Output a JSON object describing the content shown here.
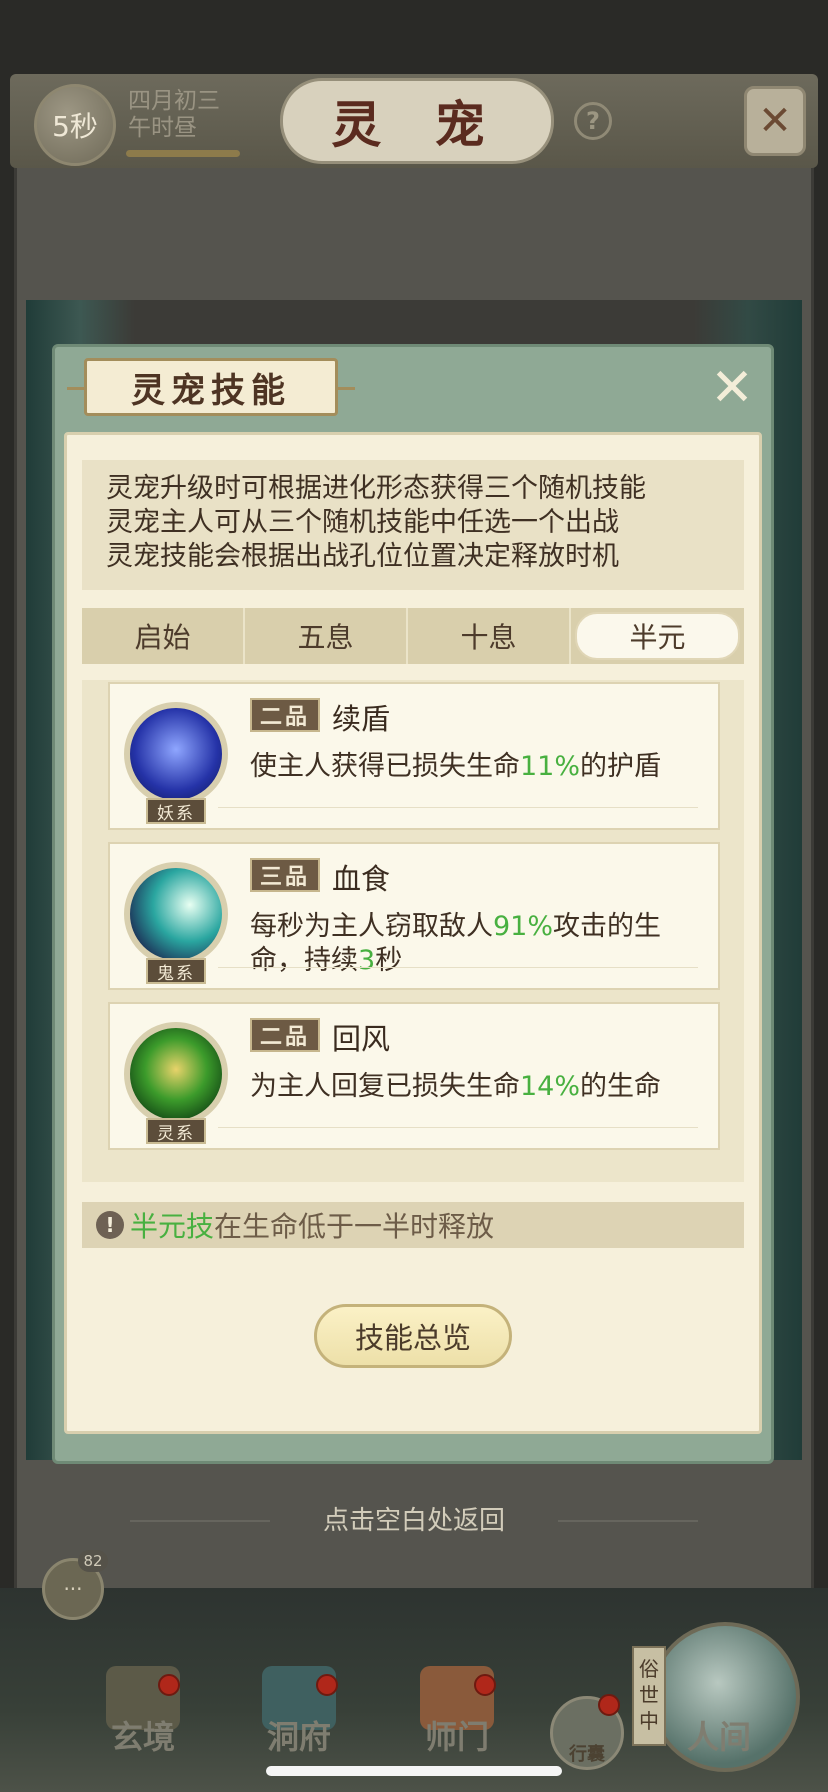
{
  "header": {
    "timer": "5秒",
    "date_line1": "四月初三",
    "date_line2": "午时昼",
    "title": "灵 宠",
    "help": "?"
  },
  "modal": {
    "title": "灵宠技能",
    "description": [
      "灵宠升级时可根据进化形态获得三个随机技能",
      "灵宠主人可从三个随机技能中任选一个出战",
      "灵宠技能会根据出战孔位位置决定释放时机"
    ],
    "tabs": [
      {
        "label": "启始",
        "active": false
      },
      {
        "label": "五息",
        "active": false
      },
      {
        "label": "十息",
        "active": false
      },
      {
        "label": "半元",
        "active": true
      }
    ],
    "skills": [
      {
        "grade": "二品",
        "name": "续盾",
        "type": "妖系",
        "desc_before": "使主人获得已损失生命",
        "highlight": "11%",
        "desc_after": "的护盾",
        "desc_mid2": "",
        "desc_end": ""
      },
      {
        "grade": "三品",
        "name": "血食",
        "type": "鬼系",
        "desc_before": "每秒为主人窃取敌人",
        "highlight": "91%",
        "desc_after": "攻击的生命，持续",
        "highlight2": "3",
        "desc_end": "秒"
      },
      {
        "grade": "二品",
        "name": "回风",
        "type": "灵系",
        "desc_before": "为主人回复已损失生命",
        "highlight": "14%",
        "desc_after": "的生命",
        "desc_mid2": "",
        "desc_end": ""
      }
    ],
    "note_highlight": "半元技",
    "note_text": "在生命低于一半时释放",
    "overview_button": "技能总览"
  },
  "return_hint": "点击空白处返回",
  "chat": {
    "count": "82"
  },
  "bottom_nav": {
    "items": [
      "玄境",
      "洞府",
      "师门"
    ],
    "bag": "行囊",
    "world_tag": "俗世中",
    "world": "人间"
  },
  "colors": {
    "highlight_green": "#48b040",
    "modal_frame": "#8fa995",
    "panel_bg": "#f6f0db"
  }
}
